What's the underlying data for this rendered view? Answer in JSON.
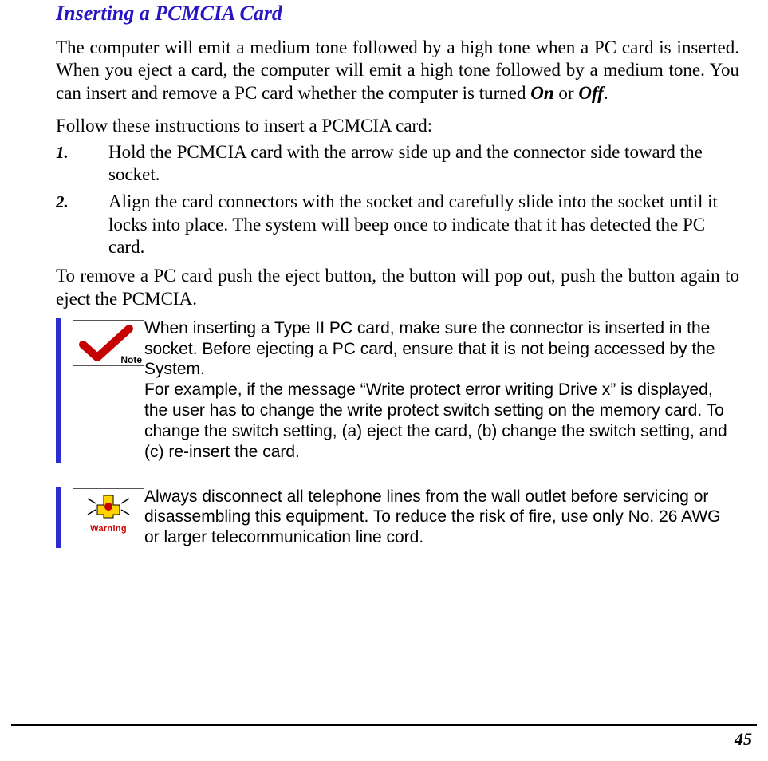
{
  "heading": "Inserting a PCMCIA Card",
  "intro_parts": {
    "p1": "The computer will emit a medium tone followed by a high tone when a PC card is inserted.  When you eject a card, the computer will emit a high tone followed by a medium tone.  You can insert and remove a PC card whether the computer is turned ",
    "on": "On",
    "mid": " or ",
    "off": "Off",
    "end": "."
  },
  "instructions_lead": "Follow these instructions to insert a PCMCIA card:",
  "steps": [
    {
      "num": "1.",
      "text": "Hold the PCMCIA card with the arrow side up and the connector side toward the socket."
    },
    {
      "num": "2.",
      "text": "Align the card connectors with the socket and carefully slide into the socket until it locks into place.  The system will beep once to indicate that it has detected the PC card."
    }
  ],
  "removal": "To remove a PC card push the eject button, the button will pop out, push the button again to eject the PCMCIA.",
  "note": {
    "icon_label": "Note",
    "text": "When inserting a Type II PC card, make sure the connector is inserted in the socket.  Before ejecting a PC card, ensure that it is not being accessed by the System.\nFor example, if the message “Write protect error writing Drive x” is displayed, the user has to change the write protect switch setting on the memory card.  To change the switch setting, (a) eject the card, (b) change the switch setting, and (c) re-insert the card."
  },
  "warning": {
    "icon_label": "Warning",
    "text": "Always disconnect all telephone lines from the wall outlet before servicing or disassembling this equipment.  To reduce the risk of fire, use only No. 26 AWG or larger telecommunication line cord."
  },
  "page_number": "45"
}
